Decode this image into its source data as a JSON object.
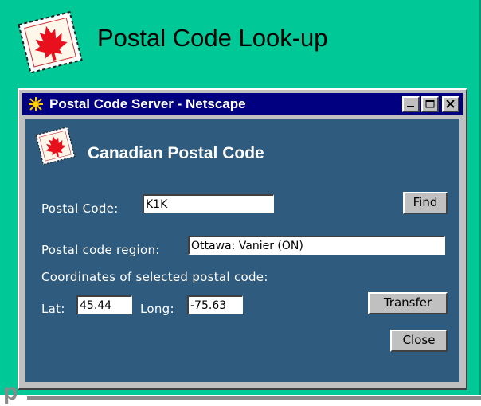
{
  "slide": {
    "title": "Postal Code Look-up",
    "cut_letter": "p"
  },
  "window": {
    "title": "Postal Code Server - Netscape",
    "controls": {
      "minimize": "minimize",
      "maximize": "maximize",
      "close": "close"
    }
  },
  "form": {
    "title": "Canadian Postal Code",
    "postal_code_label": "Postal Code:",
    "postal_code_value": "K1K",
    "find_label": "Find",
    "region_label": "Postal code region:",
    "region_value": "Ottawa: Vanier (ON)",
    "coords_label": "Coordinates of selected postal code:",
    "lat_label": "Lat:",
    "lat_value": "45.44",
    "long_label": "Long:",
    "long_value": "-75.63",
    "transfer_label": "Transfer",
    "close_label": "Close"
  },
  "icons": {
    "stamp": "maple-leaf-stamp-icon",
    "app": "netscape-icon"
  },
  "colors": {
    "slide_bg": "#00c896",
    "titlebar": "#000080",
    "form_bg": "#2f5b7e",
    "maple_red": "#e8101c"
  }
}
